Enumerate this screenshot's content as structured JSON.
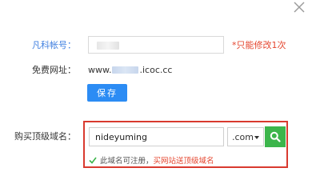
{
  "dialog": {
    "close_icon": "close-icon"
  },
  "account": {
    "label": "凡科帐号：",
    "value": "",
    "note": "*只能修改1次"
  },
  "free_url": {
    "label": "免费网址：",
    "prefix": "www.",
    "suffix": ".icoc.cc"
  },
  "save_button": {
    "label": "保存"
  },
  "buy_domain": {
    "label": "购买顶级域名：",
    "input_value": "nideyuming",
    "tld_selected": ".com",
    "search_icon": "search-icon",
    "status_icon": "check-icon",
    "status_text": "此域名可注册，",
    "status_link": "买网站送顶级域名"
  },
  "colors": {
    "primary_blue": "#2c8cf4",
    "label_blue": "#3f7fe0",
    "red": "#e5452e",
    "box_border_red": "#d93a2f",
    "green": "#3cb54b"
  }
}
